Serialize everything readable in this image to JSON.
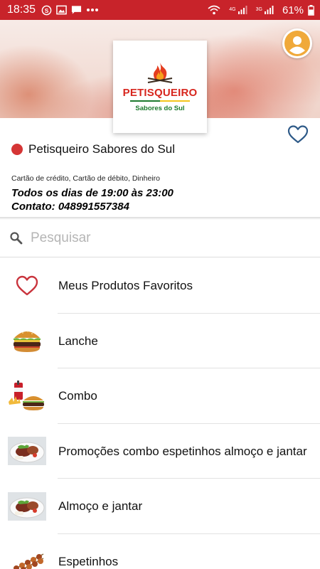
{
  "status_bar": {
    "time": "18:35",
    "network_tag_1": "4G",
    "network_tag_2": "3G",
    "battery": "61%",
    "icons": [
      "skype-icon",
      "gallery-icon",
      "chat-icon",
      "more-dots-icon",
      "wifi-icon",
      "signal-icon",
      "battery-icon"
    ],
    "background_color": "#c8232a"
  },
  "store": {
    "logo_brand": "PETISQUEIRO",
    "logo_subtitle": "Sabores do Sul",
    "name": "Petisqueiro Sabores do Sul",
    "status_color": "#d53535",
    "payments": "Cartão de crédito, Cartão de débito, Dinheiro",
    "hours": "Todos os dias de 19:00 às 23:00",
    "contact": "Contato: 048991557384"
  },
  "search": {
    "placeholder": "Pesquisar",
    "value": ""
  },
  "categories": [
    {
      "label": "Meus Produtos Favoritos",
      "icon": "heart-outline-icon"
    },
    {
      "label": "Lanche",
      "icon": "burger-icon"
    },
    {
      "label": "Combo",
      "icon": "combo-meal-icon"
    },
    {
      "label": "Promoções combo espetinhos almoço e jantar",
      "icon": "plate-meal-icon"
    },
    {
      "label": "Almoço e jantar",
      "icon": "plate-meal-icon"
    },
    {
      "label": "Espetinhos",
      "icon": "skewers-icon"
    }
  ],
  "colors": {
    "accent_red": "#c8232a",
    "favorite_heart": "#2e5a88",
    "avatar": "#f0a93a"
  }
}
